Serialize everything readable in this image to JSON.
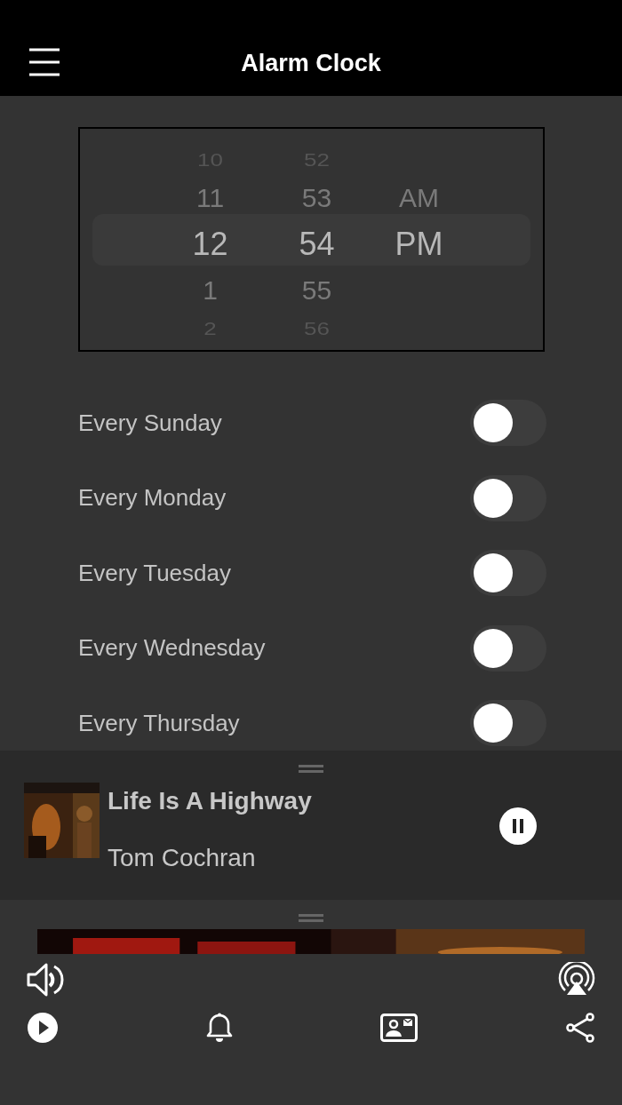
{
  "header": {
    "title": "Alarm Clock"
  },
  "picker": {
    "columns": [
      {
        "items": [
          {
            "text": "10",
            "selected": false
          },
          {
            "text": "11",
            "selected": false
          },
          {
            "text": "12",
            "selected": true
          },
          {
            "text": "1",
            "selected": false
          },
          {
            "text": "2",
            "selected": false
          }
        ]
      },
      {
        "items": [
          {
            "text": "52",
            "selected": false
          },
          {
            "text": "53",
            "selected": false
          },
          {
            "text": "54",
            "selected": true
          },
          {
            "text": "55",
            "selected": false
          },
          {
            "text": "56",
            "selected": false
          }
        ]
      },
      {
        "items": [
          {
            "text": "AM",
            "selected": false
          },
          {
            "text": "PM",
            "selected": true
          }
        ]
      }
    ]
  },
  "days": [
    {
      "label": "Every Sunday",
      "on": false
    },
    {
      "label": "Every Monday",
      "on": false
    },
    {
      "label": "Every Tuesday",
      "on": false
    },
    {
      "label": "Every Wednesday",
      "on": false
    },
    {
      "label": "Every Thursday",
      "on": false
    }
  ],
  "now_playing": {
    "title": "Life Is A Highway",
    "artist": "Tom Cochran",
    "playing": true
  }
}
